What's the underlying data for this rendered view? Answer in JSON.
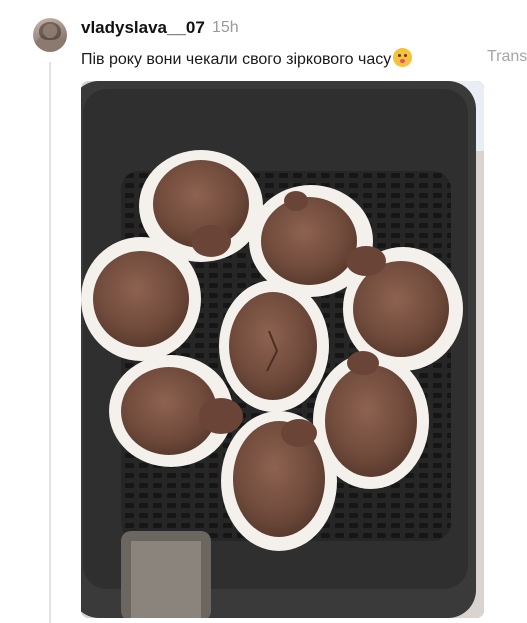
{
  "post": {
    "username": "vladyslava__07",
    "time": "15h",
    "caption": "Пів року вони чекали свого зіркового часу",
    "translate_label": "Trans"
  },
  "icons": {
    "emoji": "kissing-face-icon"
  },
  "media": {
    "description_icon": "photo"
  },
  "colors": {
    "username": "#111111",
    "time": "#9a9a9a",
    "translate": "#a5a5a5",
    "thread_line": "#e3e3e3",
    "basket": "#2b2b2b",
    "cupcake": "#7b5545",
    "liner": "#f4f1ec"
  }
}
